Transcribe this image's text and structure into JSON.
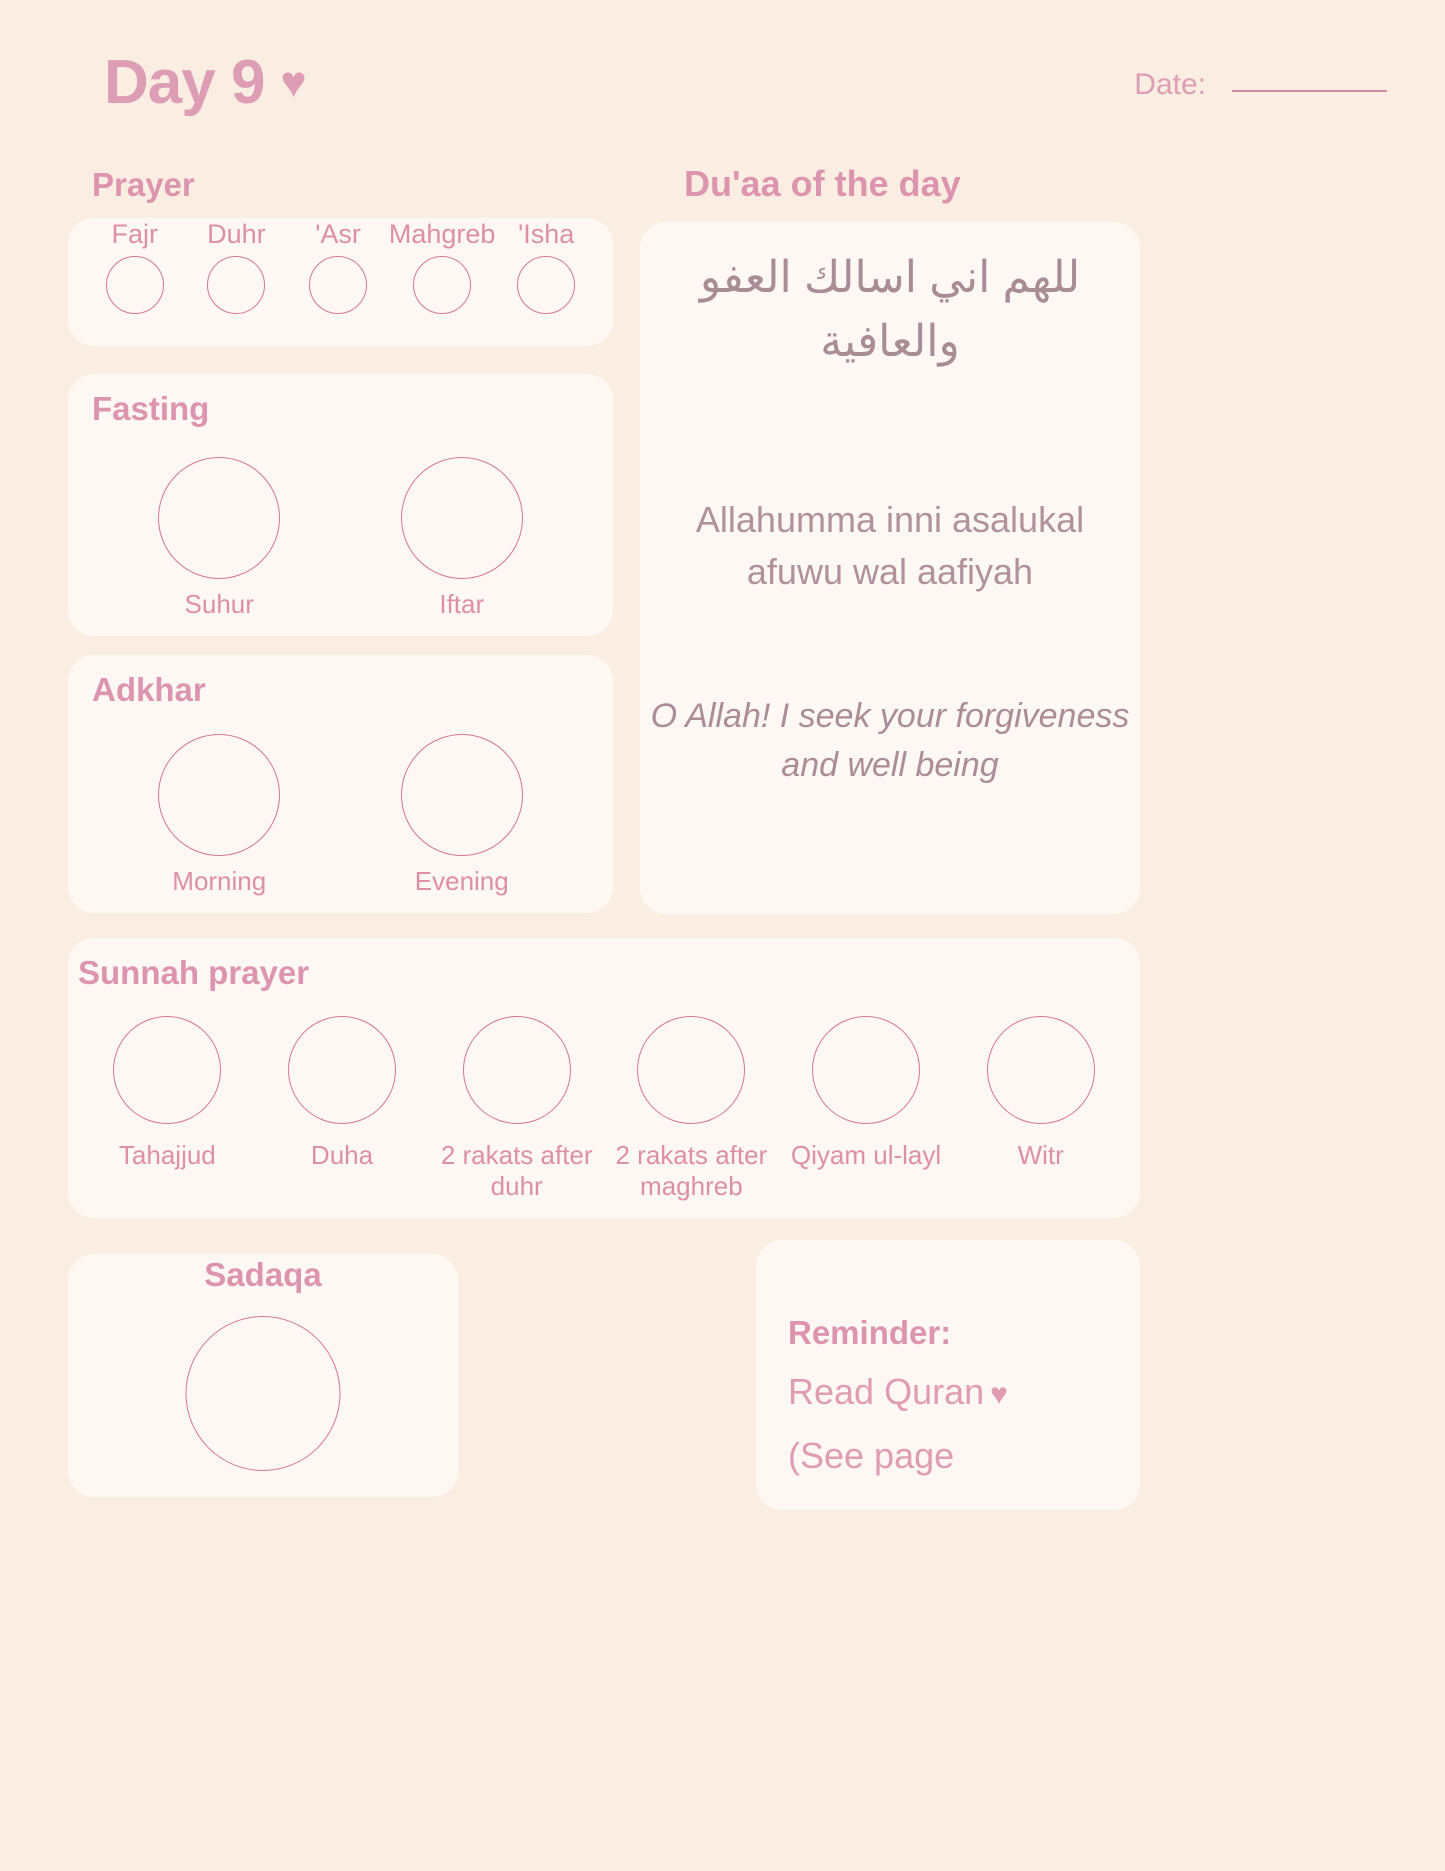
{
  "header": {
    "day_title": "Day 9",
    "heart_icon": "heart-icon",
    "date_label": "Date:",
    "date_value": ""
  },
  "colors": {
    "page_background": "#faeee3",
    "card_background": "#fdf8f4",
    "accent_pink": "#dd94ae",
    "label_pink": "#dd8fa6",
    "circle_outline": "#d2788f",
    "muted_text": "#a98d94"
  },
  "prayer": {
    "title": "Prayer",
    "items": [
      {
        "label": "Fajr"
      },
      {
        "label": "Duhr"
      },
      {
        "label": "'Asr"
      },
      {
        "label": "Mahgreb"
      },
      {
        "label": "'Isha"
      }
    ]
  },
  "fasting": {
    "title": "Fasting",
    "items": [
      {
        "label": "Suhur"
      },
      {
        "label": "Iftar"
      }
    ]
  },
  "adkhar": {
    "title": "Adkhar",
    "items": [
      {
        "label": "Morning"
      },
      {
        "label": "Evening"
      }
    ]
  },
  "sunnah": {
    "title": "Sunnah prayer",
    "items": [
      {
        "label": "Tahajjud"
      },
      {
        "label": "Duha"
      },
      {
        "label": "2 rakats after duhr"
      },
      {
        "label": "2 rakats after maghreb"
      },
      {
        "label": "Qiyam ul-layl"
      },
      {
        "label": "Witr"
      }
    ]
  },
  "sadaqa": {
    "title": "Sadaqa"
  },
  "reminder": {
    "heading": "Reminder:",
    "line1": "Read Quran",
    "heart_icon": "heart-icon",
    "line2": "(See page"
  },
  "duaa": {
    "title": "Du'aa of the day",
    "arabic": "للهم اني اسالك العفو والعافية",
    "transliteration": "Allahumma inni asalukal afuwu wal aafiyah",
    "translation": "O Allah! I seek your forgiveness and well being"
  }
}
